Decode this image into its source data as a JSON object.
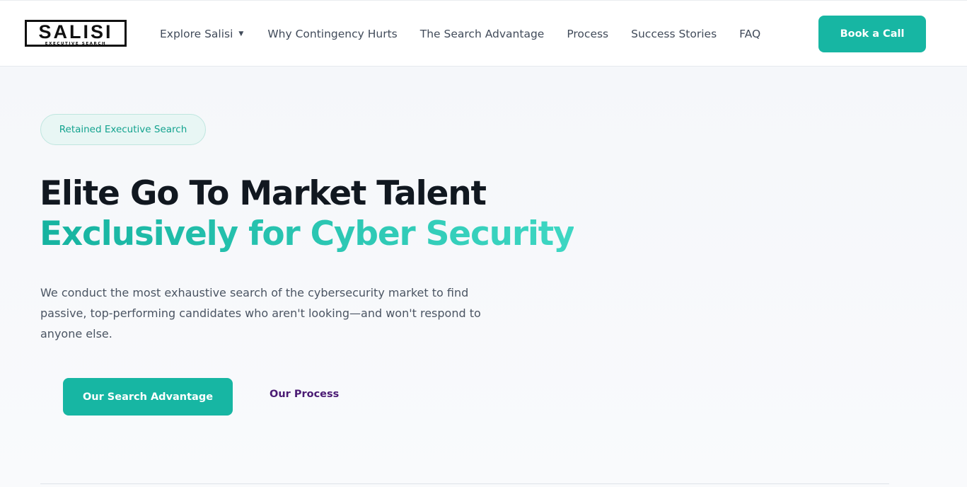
{
  "brand": {
    "logo_word": "SALISI",
    "logo_tagline": "EXECUTIVE SEARCH"
  },
  "nav": {
    "items": [
      {
        "label": "Explore Salisi",
        "has_dropdown": true
      },
      {
        "label": "Why Contingency Hurts"
      },
      {
        "label": "The Search Advantage"
      },
      {
        "label": "Process"
      },
      {
        "label": "Success Stories"
      },
      {
        "label": "FAQ"
      }
    ],
    "dropdown_caret": "▼",
    "cta_label": "Book a Call"
  },
  "hero": {
    "badge": "Retained Executive Search",
    "headline_line1": "Elite Go To Market Talent",
    "headline_line2": "Exclusively for Cyber Security",
    "description": "We conduct the most exhaustive search of the cybersecurity market to find passive, top-performing candidates who aren't looking—and won't respond to anyone else.",
    "primary_button": "Our Search Advantage",
    "secondary_link": "Our Process"
  },
  "colors": {
    "accent": "#17b6a3",
    "accent_light": "#3ed7c3",
    "heading": "#111820",
    "body_text": "#4b5563",
    "link_purple": "#4b1b74"
  }
}
